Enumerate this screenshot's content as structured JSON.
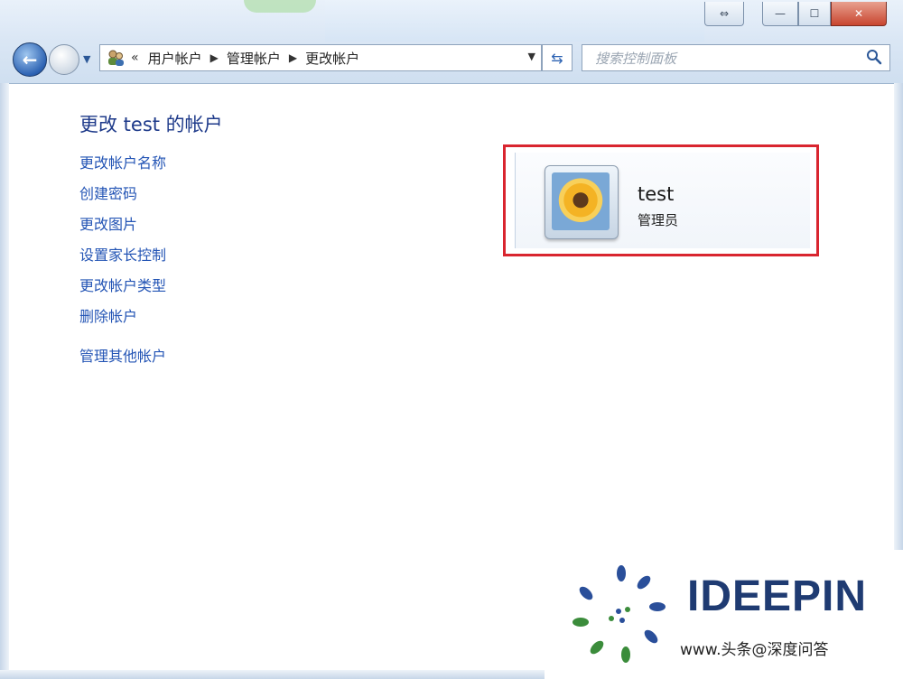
{
  "window": {
    "controls": {
      "restore": "⇔",
      "minimize": "—",
      "maximize": "☐",
      "close": "✕"
    }
  },
  "address_bar": {
    "overflow": "«",
    "crumbs": [
      "用户帐户",
      "管理帐户",
      "更改帐户"
    ]
  },
  "search": {
    "placeholder": "搜索控制面板"
  },
  "page": {
    "heading": "更改 test 的帐户",
    "links": [
      "更改帐户名称",
      "创建密码",
      "更改图片",
      "设置家长控制",
      "更改帐户类型",
      "删除帐户"
    ],
    "other_link": "管理其他帐户"
  },
  "account": {
    "name": "test",
    "role": "管理员"
  },
  "watermark": {
    "brand": "IDEEPIN",
    "subtitle": "www.头条@深度问答"
  },
  "colors": {
    "link": "#2455b5",
    "heading": "#1e3a8a",
    "highlight": "#d9252f"
  }
}
